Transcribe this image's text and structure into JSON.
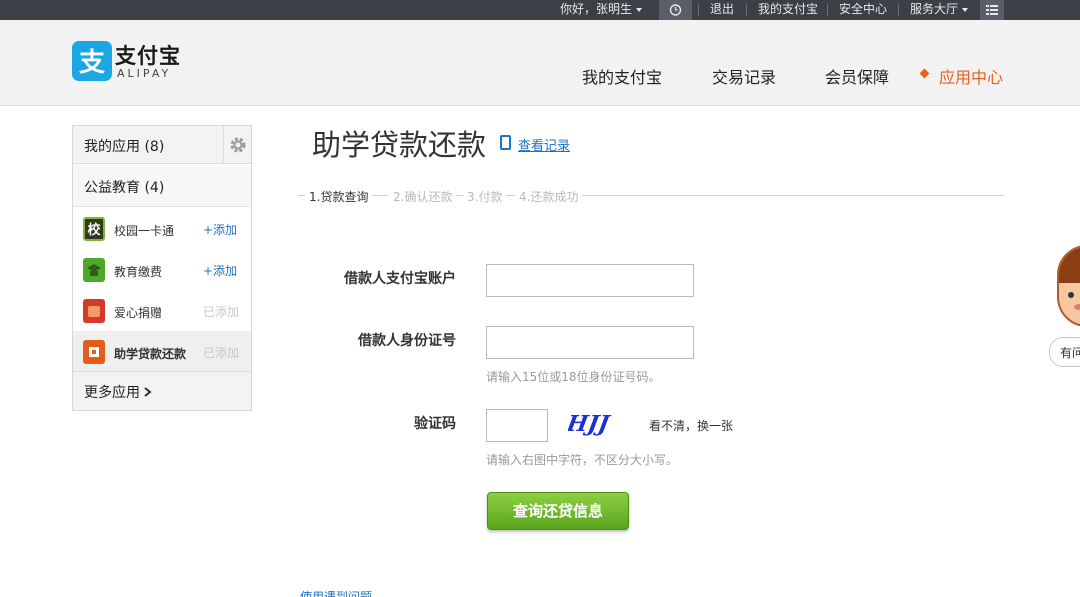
{
  "topbar": {
    "greeting": "你好，张明生",
    "logout": "退出",
    "my_alipay": "我的支付宝",
    "security": "安全中心",
    "service": "服务大厅"
  },
  "header": {
    "logo_icon": "支",
    "logo_cn": "支付宝",
    "logo_en": "ALIPAY",
    "nav": [
      "我的支付宝",
      "交易记录",
      "会员保障",
      "应用中心"
    ],
    "active_nav": "应用中心",
    "accent_color": "#e9611a"
  },
  "sidebar": {
    "title": "我的应用 (8)",
    "category": "公益教育 (4)",
    "items": [
      {
        "label": "校园一卡通",
        "action": "+添加",
        "icon": "campus-card-icon",
        "icon_text": "校",
        "color": "#2f3a1e"
      },
      {
        "label": "教育缴费",
        "action": "+添加",
        "icon": "education-fee-icon",
        "color": "#4ea82a"
      },
      {
        "label": "爱心捐赠",
        "action": "已添加",
        "icon": "donation-icon",
        "color": "#d43a25"
      },
      {
        "label": "助学贷款还款",
        "action": "已添加",
        "icon": "student-loan-icon",
        "color": "#e65a1a"
      }
    ],
    "more": "更多应用"
  },
  "main": {
    "title": "助学贷款还款",
    "record_link": "查看记录",
    "steps": [
      "1.贷款查询",
      "2.确认还款",
      "3.付款",
      "4.还款成功"
    ],
    "active_step": 0,
    "form": {
      "account_label": "借款人支付宝账户",
      "account_value": "",
      "id_label": "借款人身份证号",
      "id_value": "",
      "id_hint": "请输入15位或18位身份证号码。",
      "captcha_label": "验证码",
      "captcha_value": "",
      "captcha_text": "HJJ",
      "captcha_refresh": "看不清，换一张",
      "captcha_hint": "请输入右图中字符，不区分大小写。"
    },
    "submit": "查询还贷信息",
    "footer_link": "使用遇到问题"
  },
  "helper": {
    "button": "有问"
  }
}
